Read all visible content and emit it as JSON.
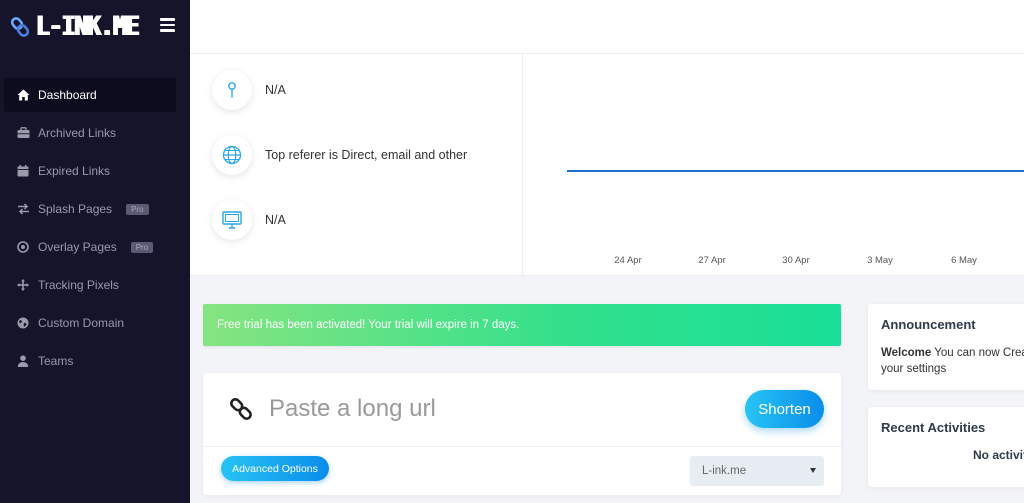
{
  "brand": {
    "name": "L-INK.ME"
  },
  "sidebar": {
    "items": [
      {
        "label": "Dashboard",
        "icon": "home-icon",
        "active": true,
        "badge": ""
      },
      {
        "label": "Archived Links",
        "icon": "briefcase-icon",
        "active": false,
        "badge": ""
      },
      {
        "label": "Expired Links",
        "icon": "calendar-icon",
        "active": false,
        "badge": ""
      },
      {
        "label": "Splash Pages",
        "icon": "swap-arrows-icon",
        "active": false,
        "badge": "Pro"
      },
      {
        "label": "Overlay Pages",
        "icon": "target-icon",
        "active": false,
        "badge": "Pro"
      },
      {
        "label": "Tracking Pixels",
        "icon": "move-arrows-icon",
        "active": false,
        "badge": ""
      },
      {
        "label": "Custom Domain",
        "icon": "globe-icon",
        "active": false,
        "badge": ""
      },
      {
        "label": "Teams",
        "icon": "user-icon",
        "active": false,
        "badge": ""
      }
    ]
  },
  "stats": {
    "location": "N/A",
    "referer": "Top referer is Direct, email and other",
    "device": "N/A"
  },
  "chart_data": {
    "type": "line",
    "x": [
      "24 Apr",
      "27 Apr",
      "30 Apr",
      "3 May",
      "6 May"
    ],
    "series": [
      {
        "values": [
          0,
          0,
          0,
          0,
          0
        ]
      }
    ],
    "color": "#1f6fd1"
  },
  "alert": {
    "text": "Free trial has been activated! Your trial will expire in 7 days."
  },
  "shortener": {
    "placeholder": "Paste a long url",
    "shorten_label": "Shorten",
    "advanced_label": "Advanced Options",
    "domain_value": "L-ink.me"
  },
  "announcement": {
    "title": "Announcement",
    "welcome": "Welcome",
    "text": " You can now Crea",
    "text2": "your settings"
  },
  "recent": {
    "title": "Recent Activities",
    "empty": "No activit"
  },
  "colors": {
    "sidebar": "#15142b",
    "accent": "#0a8dea",
    "alert": "#2fe08c"
  }
}
